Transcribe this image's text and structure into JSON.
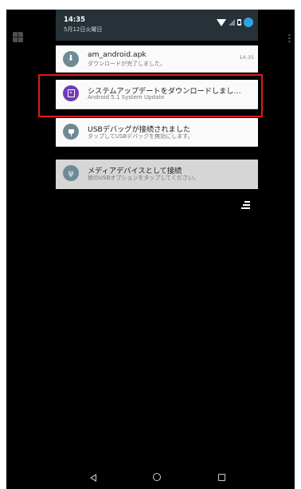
{
  "status": {
    "time": "14:35",
    "date": "5月12日火曜日"
  },
  "notifications": [
    {
      "title": "am_android.apk",
      "subtitle": "ダウンロードが完了しました。",
      "stamp": "14:35",
      "icon": "download-icon"
    },
    {
      "title": "システムアップデートをダウンロードしまし…",
      "subtitle": "Android 5.1 System Update",
      "icon": "system-update-icon"
    },
    {
      "title": "USBデバッグが接続されました",
      "subtitle": "タップしてUSBデバッグを無効にします。",
      "icon": "usb-debug-icon"
    },
    {
      "title": "メディアデバイスとして接続",
      "subtitle": "他のUSBオプションをタップしてください。",
      "icon": "usb-icon"
    }
  ],
  "colors": {
    "shade_header": "#263238",
    "update_badge": "#6f3db7",
    "highlight_box": "#e01818"
  }
}
